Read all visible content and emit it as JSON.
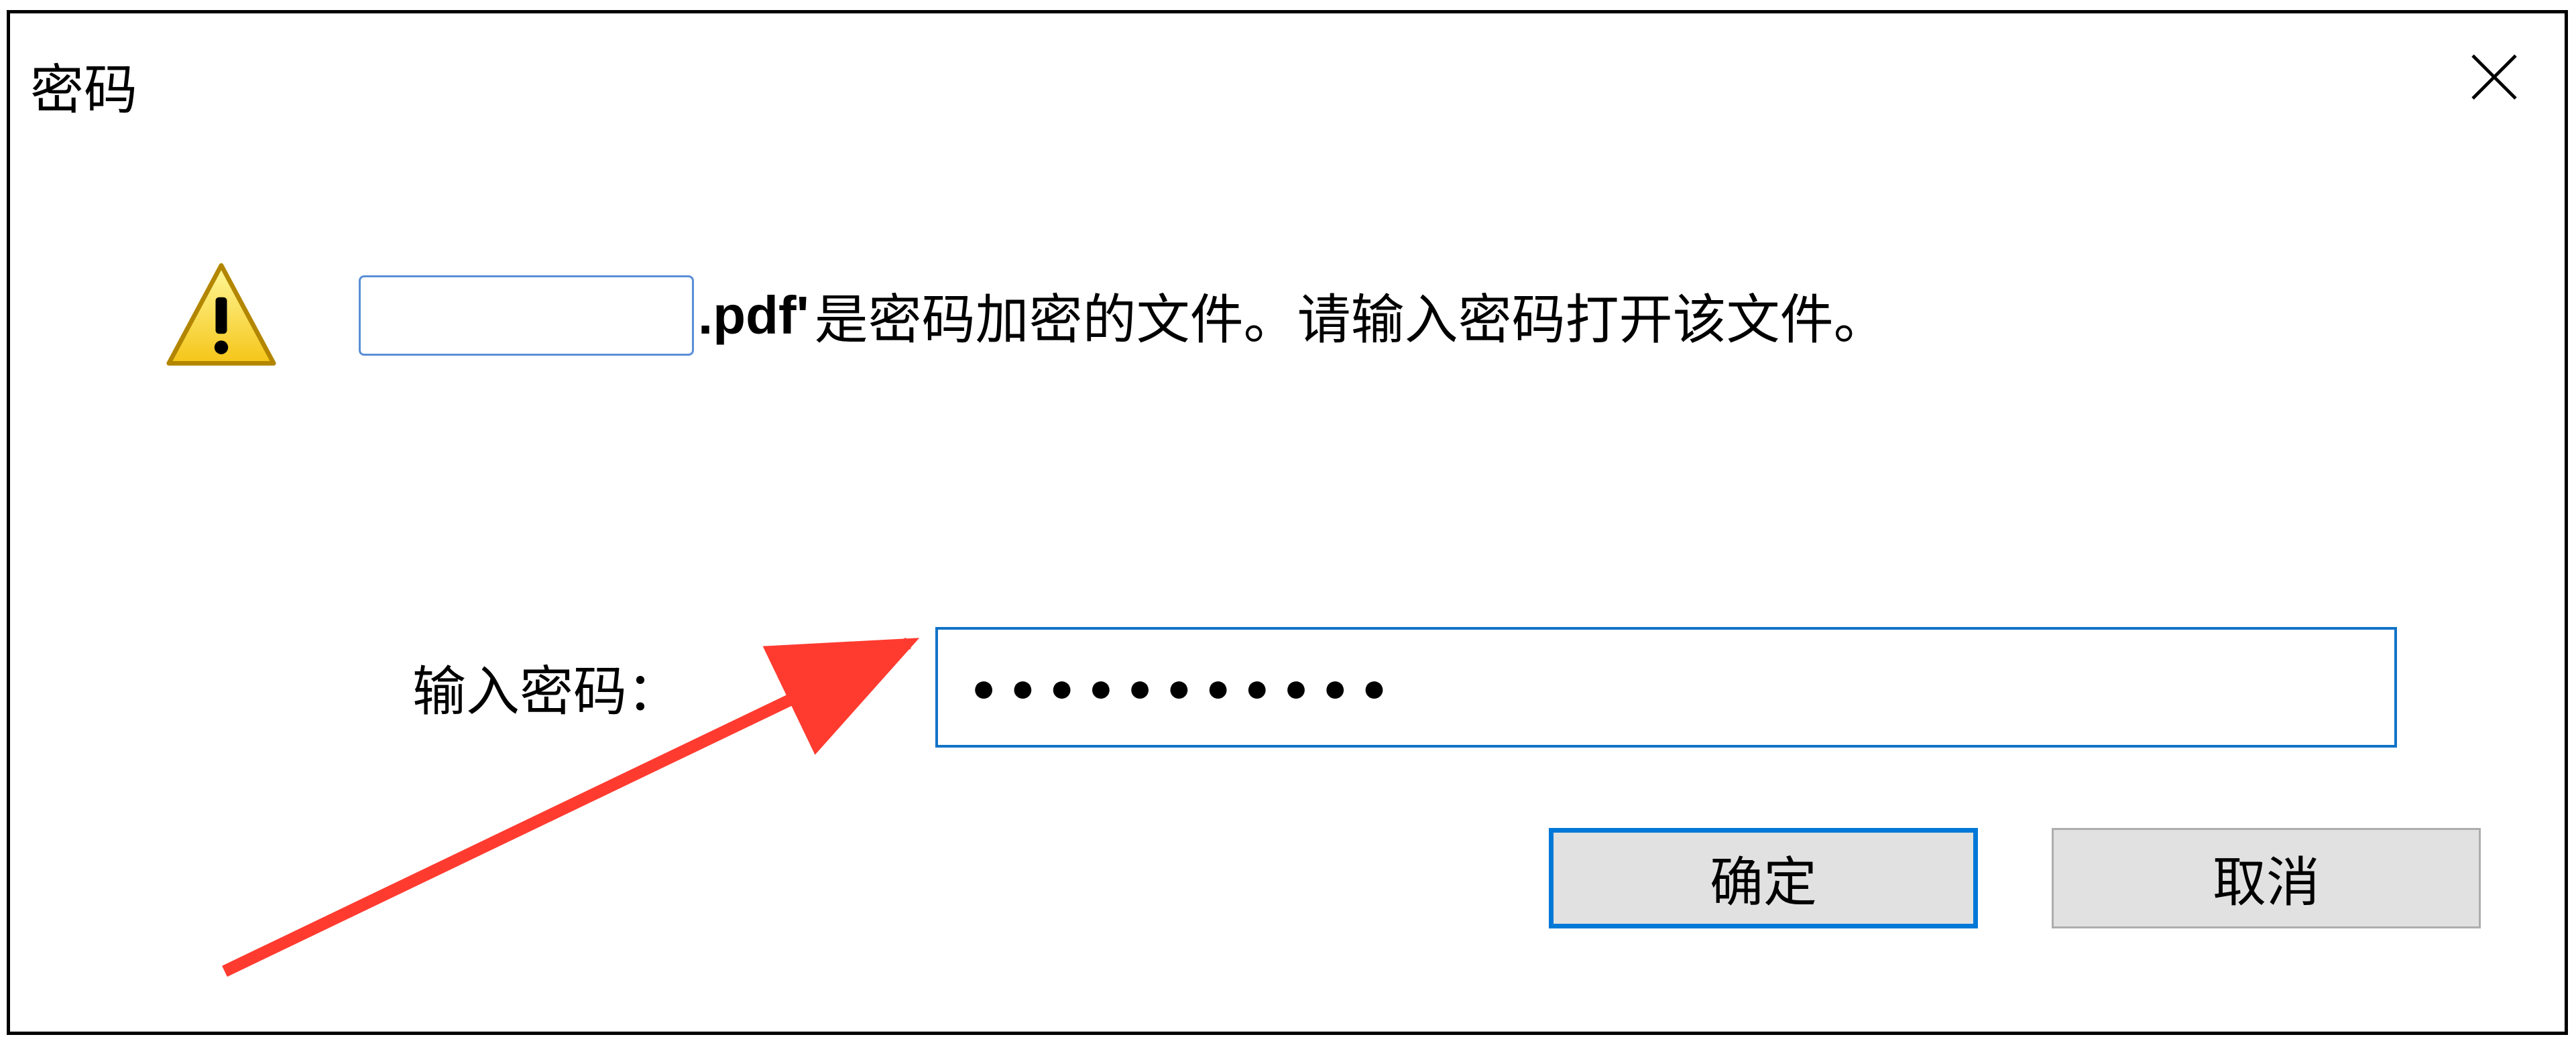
{
  "dialog": {
    "title": "密码",
    "message": {
      "filename_ext": ".pdf'",
      "rest": " 是密码加密的文件。请输入密码打开该文件。"
    },
    "password": {
      "label": "输入密码：",
      "value": "●●●●●●●●●●●"
    },
    "buttons": {
      "ok": "确定",
      "cancel": "取消"
    }
  }
}
